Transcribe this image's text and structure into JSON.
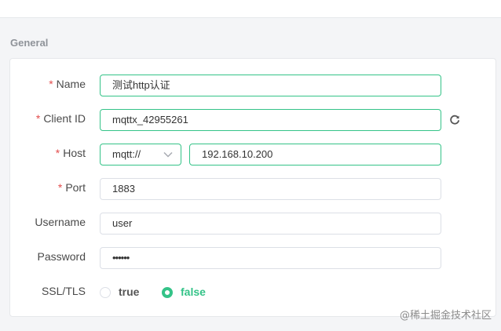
{
  "section": {
    "title": "General"
  },
  "form": {
    "name": {
      "label": "Name",
      "required": "*",
      "value": "测试http认证"
    },
    "client_id": {
      "label": "Client ID",
      "required": "*",
      "value": "mqttx_42955261",
      "action_icon": "refresh-icon"
    },
    "host": {
      "label": "Host",
      "required": "*",
      "protocol": "mqtt://",
      "protocol_icon": "chevron-down-icon",
      "value": "192.168.10.200"
    },
    "port": {
      "label": "Port",
      "required": "*",
      "value": "1883"
    },
    "username": {
      "label": "Username",
      "value": "user"
    },
    "password": {
      "label": "Password",
      "value": "••••••"
    },
    "ssl_tls": {
      "label": "SSL/TLS",
      "options": [
        "true",
        "false"
      ],
      "selected": "false"
    }
  },
  "watermark": "@稀土掘金技术社区",
  "colors": {
    "accent": "#34c388",
    "required": "#e34d4d",
    "label": "#4a4a4a",
    "section_title": "#8f9399"
  }
}
